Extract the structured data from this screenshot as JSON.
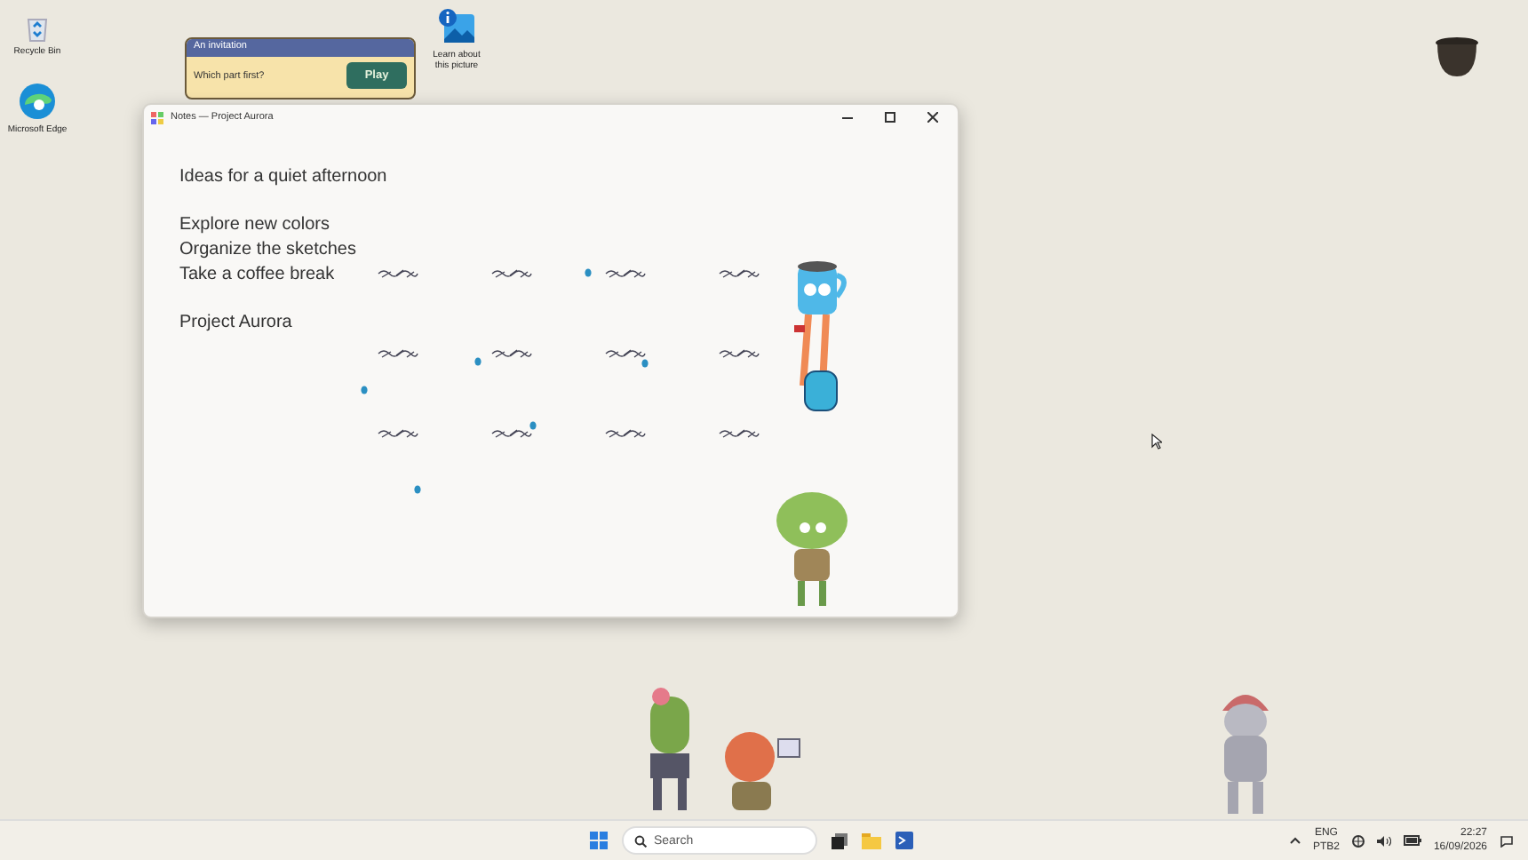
{
  "desktop_icons": [
    {
      "kind": "recycle",
      "label": "Recycle Bin"
    },
    {
      "kind": "edge",
      "label": "Microsoft Edge"
    },
    {
      "kind": "picture",
      "label": "Learn about this picture"
    }
  ],
  "popup": {
    "title": "An invitation",
    "message": "Which part first?",
    "button": "Play"
  },
  "window": {
    "title": "Notes — Project Aurora",
    "heading": "Ideas for a quiet afternoon",
    "items": [
      "Explore new colors",
      "Organize the sketches",
      "Take a coffee break"
    ],
    "footer": "Project Aurora"
  },
  "taskbar": {
    "search_placeholder": "Search",
    "language": "ENG",
    "layout": "PTB2",
    "time": "22:27",
    "date": "16/09/2026"
  }
}
